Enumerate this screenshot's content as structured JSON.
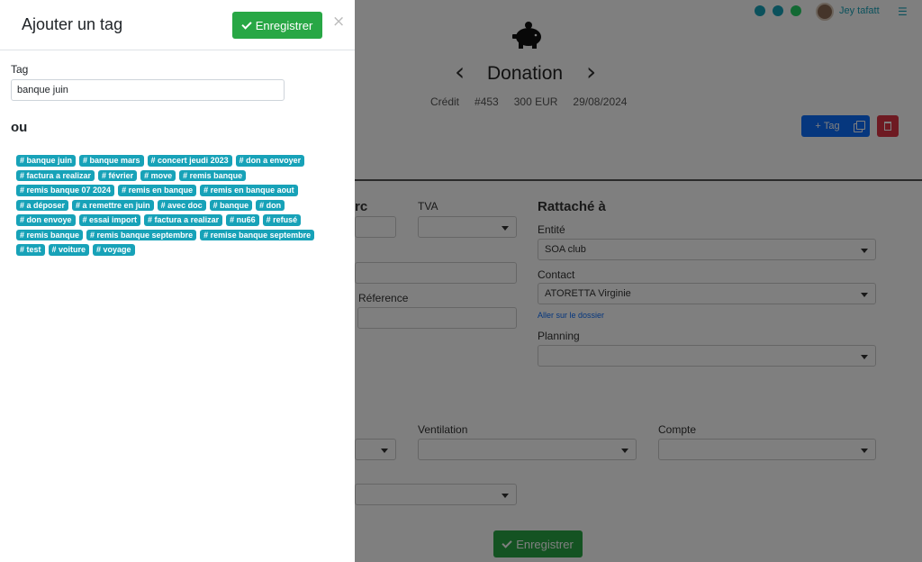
{
  "topbar": {
    "user_name": "Jey tafatt",
    "icons": [
      "sun-icon",
      "gear-icon",
      "whatsapp-icon",
      "menu-icon"
    ],
    "icon_colors": [
      "#17a2b8",
      "#17a2b8",
      "#25d366"
    ]
  },
  "record": {
    "title": "Donation",
    "type": "Crédit",
    "number": "#453",
    "amount": "300 EUR",
    "date": "29/08/2024",
    "add_tag_label": "Tag"
  },
  "form": {
    "partial_label": "rc",
    "tva_label": "TVA",
    "reference_label": "Réference",
    "attached_title": "Rattaché à",
    "entity_label": "Entité",
    "entity_value": "SOA club",
    "contact_label": "Contact",
    "contact_value": "ATORETTA Virginie",
    "folder_link": "Aller sur le dossier",
    "planning_label": "Planning",
    "ventilation_label": "Ventilation",
    "compte_label": "Compte",
    "save_label": "Enregistrer"
  },
  "panel": {
    "title": "Ajouter un tag",
    "save_label": "Enregistrer",
    "close_label": "×",
    "tag_label": "Tag",
    "tag_value": "banque juin",
    "or_label": "ou",
    "tags": [
      "# banque juin",
      "# banque mars",
      "# concert jeudi 2023",
      "# don a envoyer",
      "# factura a realizar",
      "# février",
      "# move",
      "# remis banque",
      "# remis banque 07 2024",
      "# remis en banque",
      "# remis en banque aout",
      "# a déposer",
      "# a remettre en juin",
      "# avec doc",
      "# banque",
      "# don",
      "# don envoye",
      "# essai import",
      "# factura a realizar",
      "# nu66",
      "# refusé",
      "# remis banque",
      "# remis banque septembre",
      "# remise banque septembre",
      "# test",
      "# voiture",
      "# voyage"
    ]
  },
  "colors": {
    "accent_green": "#28a745",
    "tag_teal": "#17a2b8",
    "primary_blue": "#0d6efd",
    "danger_red": "#dc3545"
  }
}
